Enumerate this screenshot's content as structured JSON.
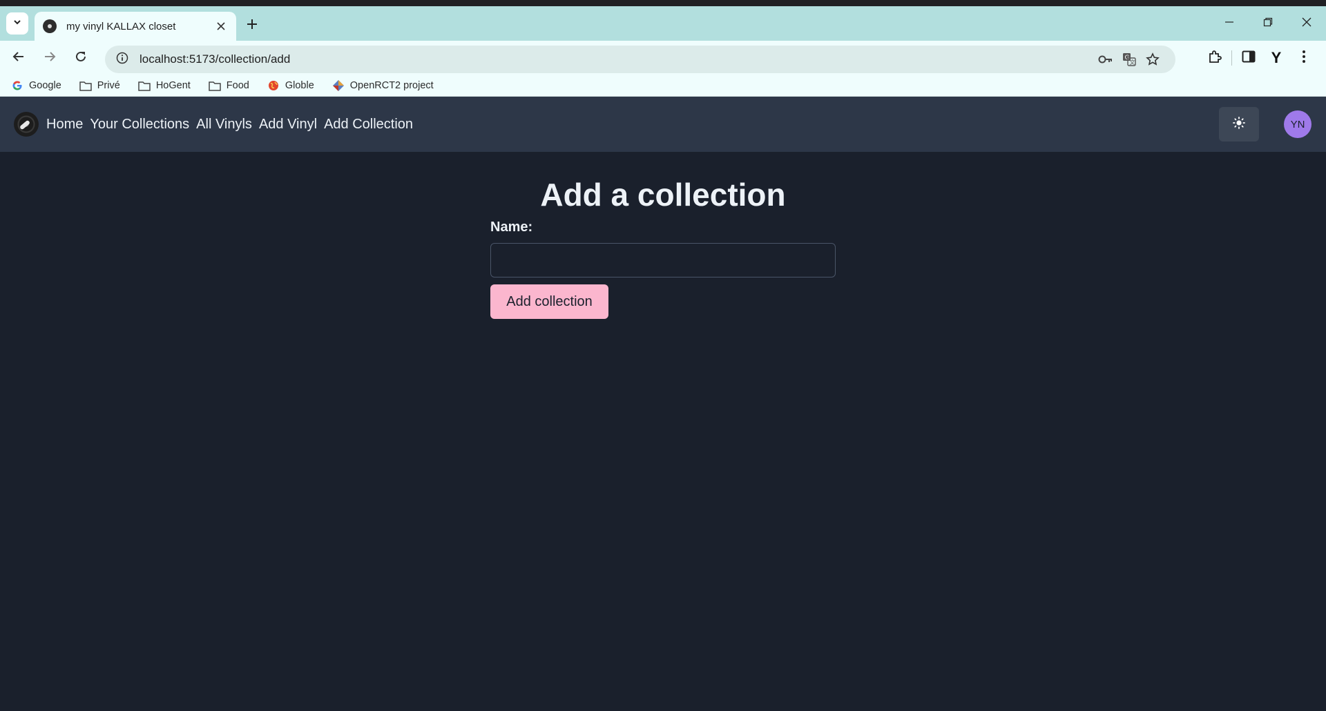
{
  "browser": {
    "tab": {
      "title": "my vinyl KALLAX closet"
    },
    "address": {
      "url": "localhost:5173/collection/add"
    },
    "bookmarks": [
      {
        "label": "Google",
        "icon": "google-icon"
      },
      {
        "label": "Privé",
        "icon": "folder-icon"
      },
      {
        "label": "HoGent",
        "icon": "folder-icon"
      },
      {
        "label": "Food",
        "icon": "folder-icon"
      },
      {
        "label": "Globle",
        "icon": "globe-icon"
      },
      {
        "label": "OpenRCT2 project",
        "icon": "openrct2-icon"
      }
    ],
    "profile_initial": "Y"
  },
  "app": {
    "nav": {
      "links": [
        "Home",
        "Your Collections",
        "All Vinyls",
        "Add Vinyl",
        "Add Collection"
      ]
    },
    "avatar_initials": "YN",
    "theme_icon": "sun-icon"
  },
  "form": {
    "title": "Add a collection",
    "name_label": "Name:",
    "name_value": "",
    "submit_label": "Add collection"
  },
  "colors": {
    "app_background": "#1a202c",
    "nav_background": "#2d3748",
    "button_pink": "#fbb6ce",
    "avatar_purple": "#9f7aea",
    "chrome_tabstrip": "#b2dfde"
  }
}
